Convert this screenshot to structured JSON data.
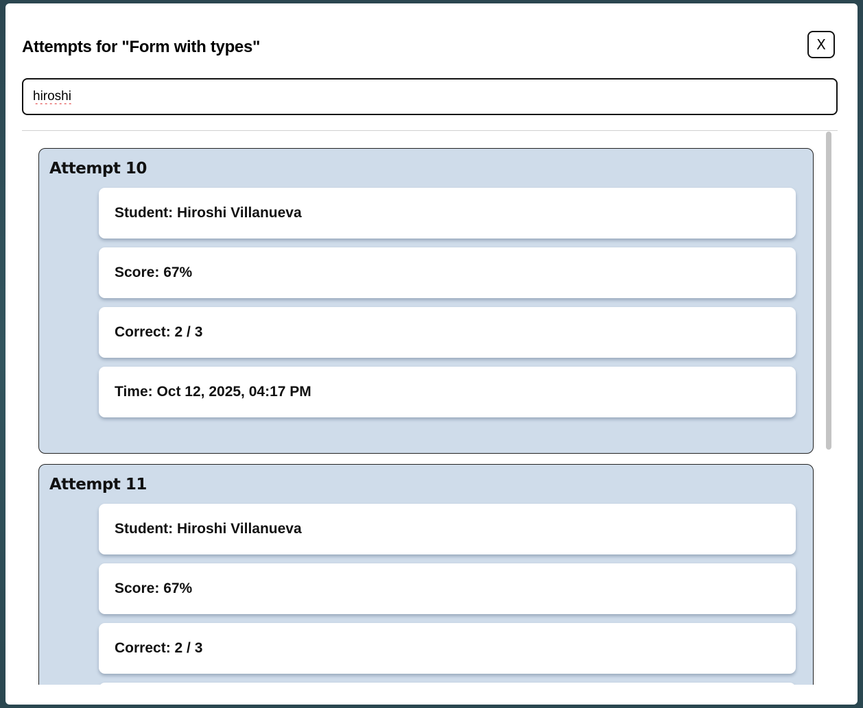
{
  "modal": {
    "title": "Attempts for \"Form with types\"",
    "close_label": "X"
  },
  "search": {
    "value": "hiroshi",
    "placeholder": ""
  },
  "attempts": [
    {
      "title": "Attempt 10",
      "fields": [
        "Student: Hiroshi Villanueva",
        "Score: 67%",
        "Correct: 2 / 3",
        "Time: Oct 12, 2025, 04:17 PM"
      ]
    },
    {
      "title": "Attempt 11",
      "fields": [
        "Student: Hiroshi Villanueva",
        "Score: 67%",
        "Correct: 2 / 3"
      ]
    }
  ],
  "colors": {
    "attempt_background": "#cfdcea",
    "card_background": "#ffffff",
    "backdrop": "#2c4a55"
  }
}
